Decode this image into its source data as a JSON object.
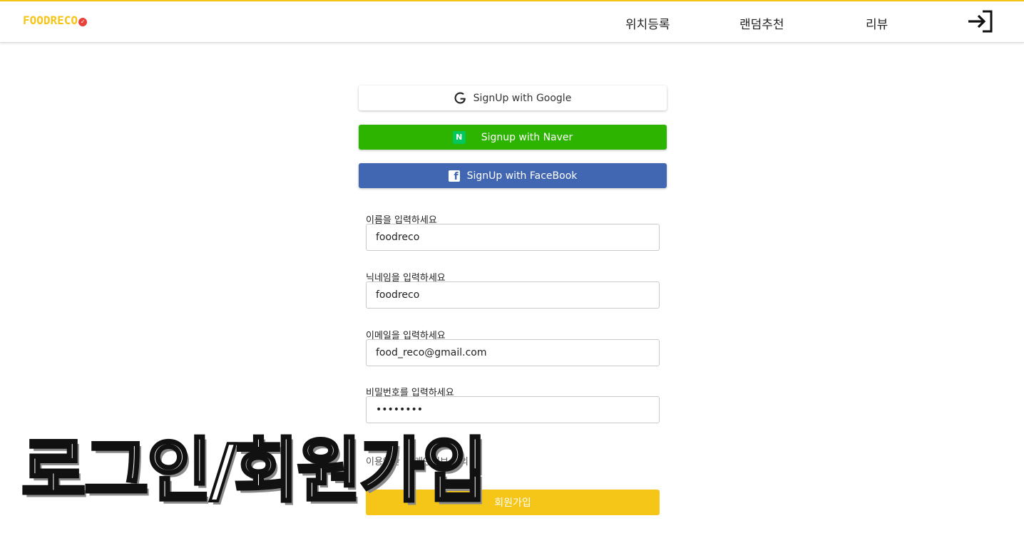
{
  "header": {
    "logo_text": "FOODRECO",
    "nav": [
      {
        "label": "위치등록"
      },
      {
        "label": "랜덤추천"
      },
      {
        "label": "리뷰"
      }
    ]
  },
  "social": {
    "google_label": "SignUp with Google",
    "naver_label": "Signup with Naver",
    "naver_badge": "N",
    "facebook_label": "SignUp with FaceBook",
    "facebook_badge": "f"
  },
  "form": {
    "name_label": "이름을 입력하세요",
    "name_value": "foodreco",
    "nickname_label": "닉네임을 입력하세요",
    "nickname_value": "foodreco",
    "email_label": "이메일을 입력하세요",
    "email_value": "food_reco@gmail.com",
    "password_label": "비밀번호를 입력하세요",
    "password_value": "••••••••",
    "agree_text": "이용약관 및 개인정보 동의",
    "submit_label": "회원가입"
  },
  "overlay": {
    "title": "로그인/회원가입"
  },
  "colors": {
    "accent": "#f5c518",
    "naver": "#2db400",
    "facebook": "#4267b2"
  }
}
